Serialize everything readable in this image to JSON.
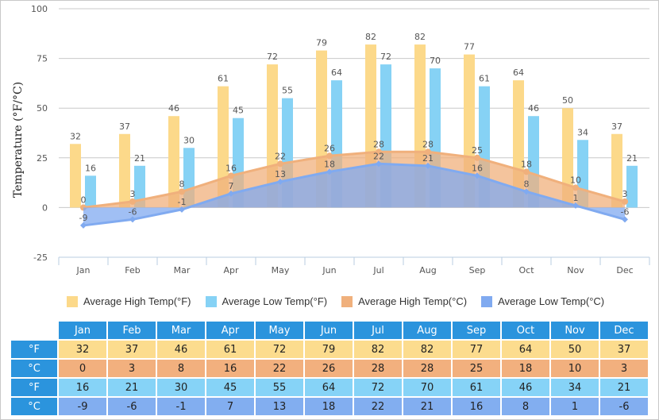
{
  "chart_data": {
    "type": "bar",
    "title": "",
    "xlabel": "",
    "ylabel": "Temperature (°F/°C)",
    "ylim": [
      -25,
      100
    ],
    "yticks": [
      100,
      75,
      50,
      25,
      0,
      -25
    ],
    "grid": true,
    "legend_position": "bottom",
    "categories": [
      "Jan",
      "Feb",
      "Mar",
      "Apr",
      "May",
      "Jun",
      "Jul",
      "Aug",
      "Sep",
      "Oct",
      "Nov",
      "Dec"
    ],
    "series": [
      {
        "name": "Average High Temp(°F)",
        "kind": "bar",
        "color": "#fcd98a",
        "values": [
          32,
          37,
          46,
          61,
          72,
          79,
          82,
          82,
          77,
          64,
          50,
          37
        ]
      },
      {
        "name": "Average Low Temp(°F)",
        "kind": "bar",
        "color": "#86d2f5",
        "values": [
          16,
          21,
          30,
          45,
          55,
          64,
          72,
          70,
          61,
          46,
          34,
          21
        ]
      },
      {
        "name": "Average High Temp(°C)",
        "kind": "area",
        "color": "#f0b07c",
        "values": [
          0,
          3,
          8,
          16,
          22,
          26,
          28,
          28,
          25,
          18,
          10,
          3
        ]
      },
      {
        "name": "Average Low Temp(°C)",
        "kind": "area",
        "color": "#80aaf0",
        "values": [
          -9,
          -6,
          -1,
          7,
          13,
          18,
          22,
          21,
          16,
          8,
          1,
          -6
        ]
      }
    ]
  },
  "table": {
    "months": [
      "Jan",
      "Feb",
      "Mar",
      "Apr",
      "May",
      "Jun",
      "Jul",
      "Aug",
      "Sep",
      "Oct",
      "Nov",
      "Dec"
    ],
    "rows": [
      {
        "unit": "°F",
        "color": "#fcdc8e",
        "values": [
          "32",
          "37",
          "46",
          "61",
          "72",
          "79",
          "82",
          "82",
          "77",
          "64",
          "50",
          "37"
        ]
      },
      {
        "unit": "°C",
        "color": "#f2b07e",
        "values": [
          "0",
          "3",
          "8",
          "16",
          "22",
          "26",
          "28",
          "28",
          "25",
          "18",
          "10",
          "3"
        ]
      },
      {
        "unit": "°F",
        "color": "#86d3f7",
        "values": [
          "16",
          "21",
          "30",
          "45",
          "55",
          "64",
          "72",
          "70",
          "61",
          "46",
          "34",
          "21"
        ]
      },
      {
        "unit": "°C",
        "color": "#82aef0",
        "values": [
          "-9",
          "-6",
          "-1",
          "7",
          "13",
          "18",
          "22",
          "21",
          "16",
          "8",
          "1",
          "-6"
        ]
      }
    ]
  }
}
